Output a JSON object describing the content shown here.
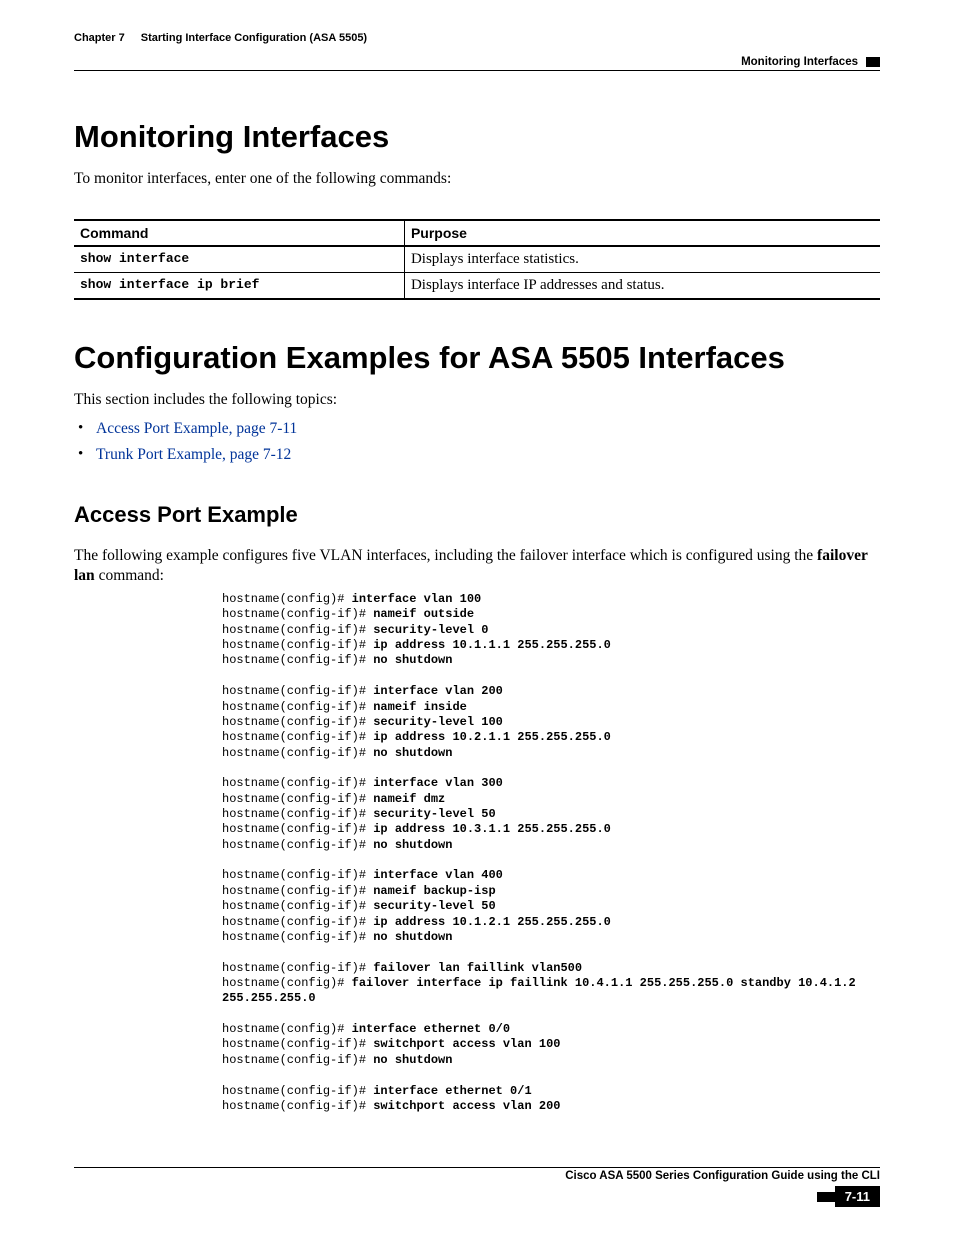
{
  "header": {
    "chapter_label": "Chapter 7",
    "chapter_title": "Starting Interface Configuration (ASA 5505)",
    "section_label": "Monitoring Interfaces"
  },
  "section_monitoring": {
    "heading": "Monitoring Interfaces",
    "intro": "To monitor interfaces, enter one of the following commands:",
    "table": {
      "header_command": "Command",
      "header_purpose": "Purpose",
      "rows": [
        {
          "command": "show interface",
          "purpose": "Displays interface statistics."
        },
        {
          "command": "show interface ip brief",
          "purpose": "Displays interface IP addresses and status."
        }
      ]
    }
  },
  "section_config": {
    "heading": "Configuration Examples for ASA 5505 Interfaces",
    "intro": "This section includes the following topics:",
    "bullets": [
      "Access Port Example, page 7-11",
      "Trunk Port Example, page 7-12"
    ]
  },
  "section_access": {
    "heading": "Access Port Example",
    "intro_pre": "The following example configures five VLAN interfaces, including the failover interface which is configured using the ",
    "intro_bold": "failover lan",
    "intro_post": " command:",
    "code": [
      {
        "p": "hostname(config)# ",
        "b": "interface vlan 100"
      },
      {
        "p": "hostname(config-if)# ",
        "b": "nameif outside"
      },
      {
        "p": "hostname(config-if)# ",
        "b": "security-level 0"
      },
      {
        "p": "hostname(config-if)# ",
        "b": "ip address 10.1.1.1 255.255.255.0"
      },
      {
        "p": "hostname(config-if)# ",
        "b": "no shutdown"
      },
      {
        "p": "",
        "b": ""
      },
      {
        "p": "hostname(config-if)# ",
        "b": "interface vlan 200"
      },
      {
        "p": "hostname(config-if)# ",
        "b": "nameif inside"
      },
      {
        "p": "hostname(config-if)# ",
        "b": "security-level 100"
      },
      {
        "p": "hostname(config-if)# ",
        "b": "ip address 10.2.1.1 255.255.255.0"
      },
      {
        "p": "hostname(config-if)# ",
        "b": "no shutdown"
      },
      {
        "p": "",
        "b": ""
      },
      {
        "p": "hostname(config-if)# ",
        "b": "interface vlan 300"
      },
      {
        "p": "hostname(config-if)# ",
        "b": "nameif dmz"
      },
      {
        "p": "hostname(config-if)# ",
        "b": "security-level 50"
      },
      {
        "p": "hostname(config-if)# ",
        "b": "ip address 10.3.1.1 255.255.255.0"
      },
      {
        "p": "hostname(config-if)# ",
        "b": "no shutdown"
      },
      {
        "p": "",
        "b": ""
      },
      {
        "p": "hostname(config-if)# ",
        "b": "interface vlan 400"
      },
      {
        "p": "hostname(config-if)# ",
        "b": "nameif backup-isp"
      },
      {
        "p": "hostname(config-if)# ",
        "b": "security-level 50"
      },
      {
        "p": "hostname(config-if)# ",
        "b": "ip address 10.1.2.1 255.255.255.0"
      },
      {
        "p": "hostname(config-if)# ",
        "b": "no shutdown"
      },
      {
        "p": "",
        "b": ""
      },
      {
        "p": "hostname(config-if)# ",
        "b": "failover lan faillink vlan500"
      },
      {
        "p": "hostname(config)# ",
        "b": "failover interface ip faillink 10.4.1.1 255.255.255.0 standby 10.4.1.2 "
      },
      {
        "p": "",
        "b": "255.255.255.0"
      },
      {
        "p": "",
        "b": ""
      },
      {
        "p": "hostname(config)# ",
        "b": "interface ethernet 0/0"
      },
      {
        "p": "hostname(config-if)# ",
        "b": "switchport access vlan 100"
      },
      {
        "p": "hostname(config-if)# ",
        "b": "no shutdown"
      },
      {
        "p": "",
        "b": ""
      },
      {
        "p": "hostname(config-if)# ",
        "b": "interface ethernet 0/1"
      },
      {
        "p": "hostname(config-if)# ",
        "b": "switchport access vlan 200"
      }
    ]
  },
  "footer": {
    "title": "Cisco ASA 5500 Series Configuration Guide using the CLI",
    "page": "7-11"
  }
}
